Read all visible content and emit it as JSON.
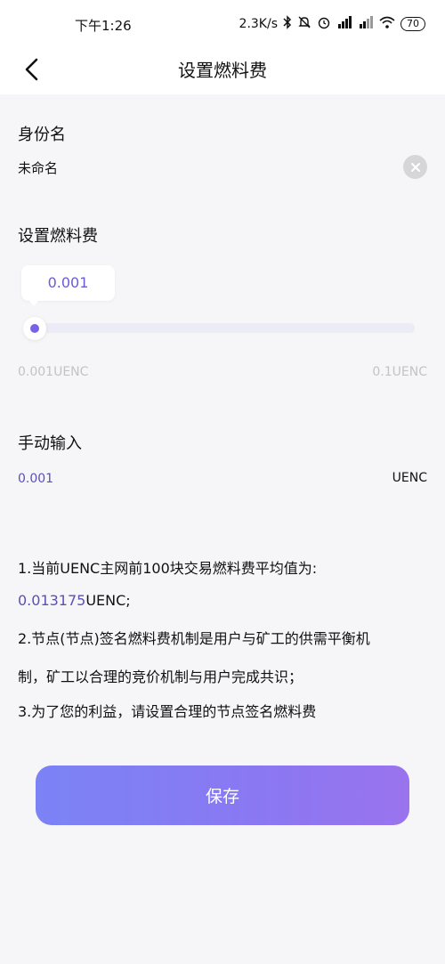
{
  "status_bar": {
    "time": "下午1:26",
    "net_speed": "2.3K/s",
    "icons": [
      "bluetooth-icon",
      "mute-icon",
      "alarm-icon",
      "signal-icon",
      "signal-icon",
      "wifi-icon"
    ],
    "battery": "70"
  },
  "nav": {
    "title": "设置燃料费"
  },
  "identity": {
    "label": "身份名",
    "value": "未命名"
  },
  "fee": {
    "label": "设置燃料费",
    "bubble_value": "0.001",
    "min_label": "0.001UENC",
    "max_label": "0.1UENC",
    "level": 0
  },
  "manual": {
    "label": "手动输入",
    "value": "0.001",
    "unit": "UENC"
  },
  "notes": {
    "line1": "1.当前UENC主网前100块交易燃料费平均值为:",
    "line2_value": "0.013175",
    "line2_unit": "UENC;",
    "line3": "2.节点(节点)签名燃料费机制是用户与矿工的供需平衡机",
    "line4": "制，矿工以合理的竞价机制与用户完成共识；",
    "line5": "3.为了您的利益，请设置合理的节点签名燃料费"
  },
  "save_label": "保存",
  "colors": {
    "accent": "#7a62e6",
    "highlight_text": "#5a4fb8",
    "button_start": "#7b83f5",
    "button_end": "#9a73ee"
  }
}
